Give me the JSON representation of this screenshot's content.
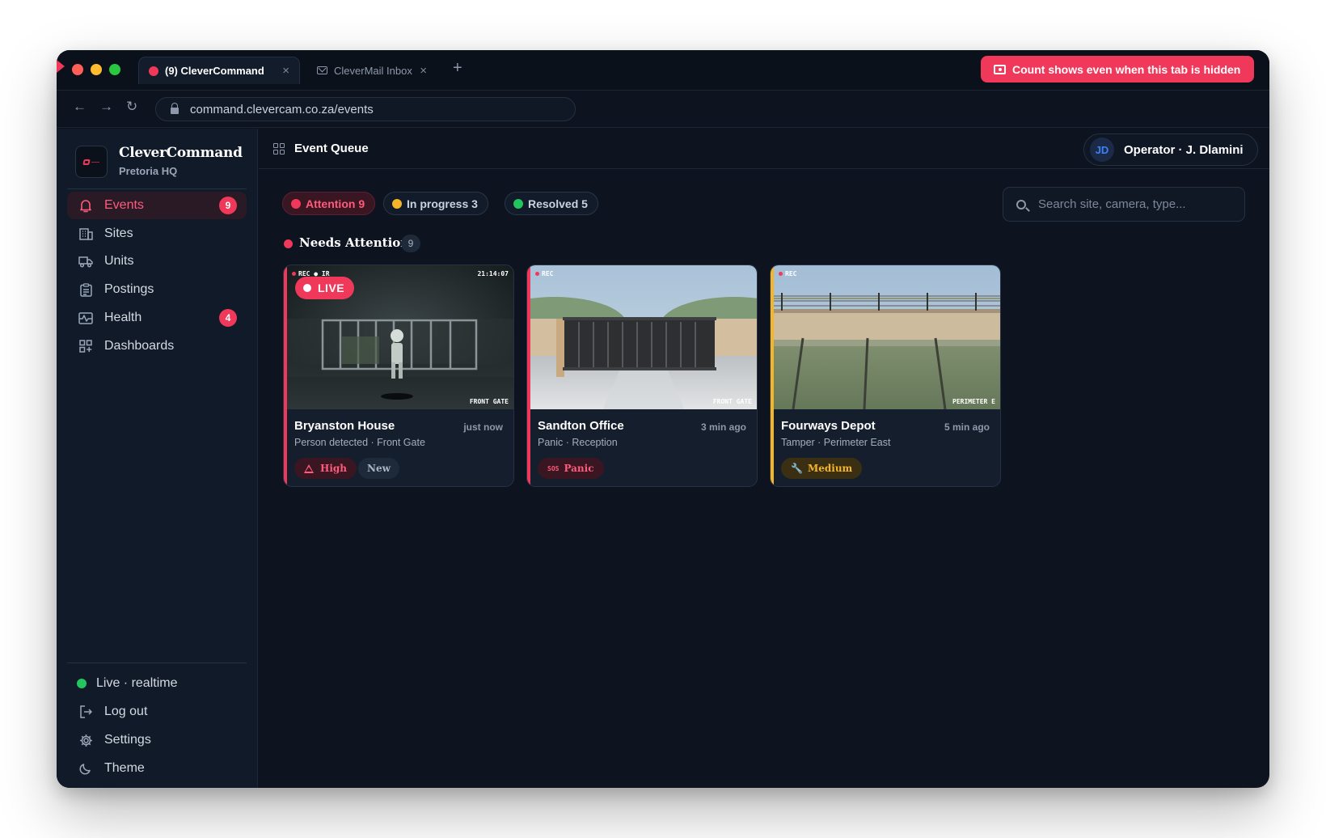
{
  "browser": {
    "tabs": [
      {
        "label": "(9) CleverCommand",
        "active": true
      },
      {
        "label": "CleverMail Inbox",
        "active": false
      }
    ],
    "new_tab": "+",
    "close_glyph": "×",
    "notice": "Count shows even when this tab is hidden",
    "url": "command.clevercam.co.za/events",
    "nav": {
      "back": "←",
      "forward": "→",
      "reload": "↻"
    }
  },
  "sidebar": {
    "brand": "CleverCommand",
    "subtitle": "Pretoria HQ",
    "items": [
      {
        "label": "Events",
        "icon": "bell-icon",
        "badge": "9",
        "active": true
      },
      {
        "label": "Sites",
        "icon": "building-icon"
      },
      {
        "label": "Units",
        "icon": "truck-icon"
      },
      {
        "label": "Postings",
        "icon": "clipboard-icon"
      },
      {
        "label": "Health",
        "icon": "pulse-icon",
        "badge": "4"
      },
      {
        "label": "Dashboards",
        "icon": "dashboard-icon"
      }
    ],
    "footer": {
      "status": "Live · realtime",
      "logout": "Log out",
      "settings": "Settings",
      "theme": "Theme"
    }
  },
  "header": {
    "title": "Event Queue",
    "operator": {
      "initials": "JD",
      "name": "Operator · J. Dlamini"
    }
  },
  "filters": [
    {
      "label": "Attention 9",
      "color": "#f0385a"
    },
    {
      "label": "In progress 3",
      "color": "#f5b528"
    },
    {
      "label": "Resolved 5",
      "color": "#22c55e"
    }
  ],
  "search": {
    "placeholder": "Search site, camera, type..."
  },
  "section": {
    "title": "Needs Attention",
    "count": "9"
  },
  "cards": [
    {
      "title": "Bryanston House",
      "time": "just now",
      "desc": "Person detected · Front Gate",
      "tags": [
        "High",
        "New"
      ],
      "accent": "#f0385a",
      "osd_top": "REC ● IR",
      "osd_time": "21:14:07",
      "osd_label": "FRONT GATE",
      "live": "LIVE"
    },
    {
      "title": "Sandton Office",
      "time": "3 min ago",
      "desc": "Panic · Reception",
      "tags": [
        "Panic"
      ],
      "sos": "SOS",
      "accent": "#f0385a",
      "osd_top": "REC",
      "osd_label": "FRONT GATE"
    },
    {
      "title": "Fourways Depot",
      "time": "5 min ago",
      "desc": "Tamper · Perimeter East",
      "tags": [
        "Medium"
      ],
      "accent": "#f5b528",
      "osd_top": "REC",
      "osd_label": "PERIMETER E"
    }
  ]
}
